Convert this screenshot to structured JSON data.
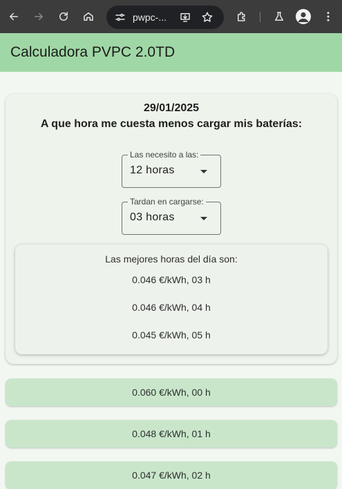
{
  "browser": {
    "url": "pwpc-..."
  },
  "app": {
    "title": "Calculadora PVPC 2.0TD"
  },
  "card": {
    "date": "29/01/2025",
    "question": "A que hora me cuesta menos cargar mis baterías:",
    "need_at": {
      "label": "Las necesito a las:",
      "value": "12 horas"
    },
    "charge_time": {
      "label": "Tardan en cargarse:",
      "value": "03 horas"
    },
    "best": {
      "heading": "Las mejores horas del día son:",
      "items": [
        "0.046 €/kWh, 03 h",
        "0.046 €/kWh, 04 h",
        "0.045 €/kWh, 05 h"
      ]
    }
  },
  "hours": [
    "0.060 €/kWh, 00 h",
    "0.048 €/kWh, 01 h",
    "0.047 €/kWh, 02 h"
  ]
}
